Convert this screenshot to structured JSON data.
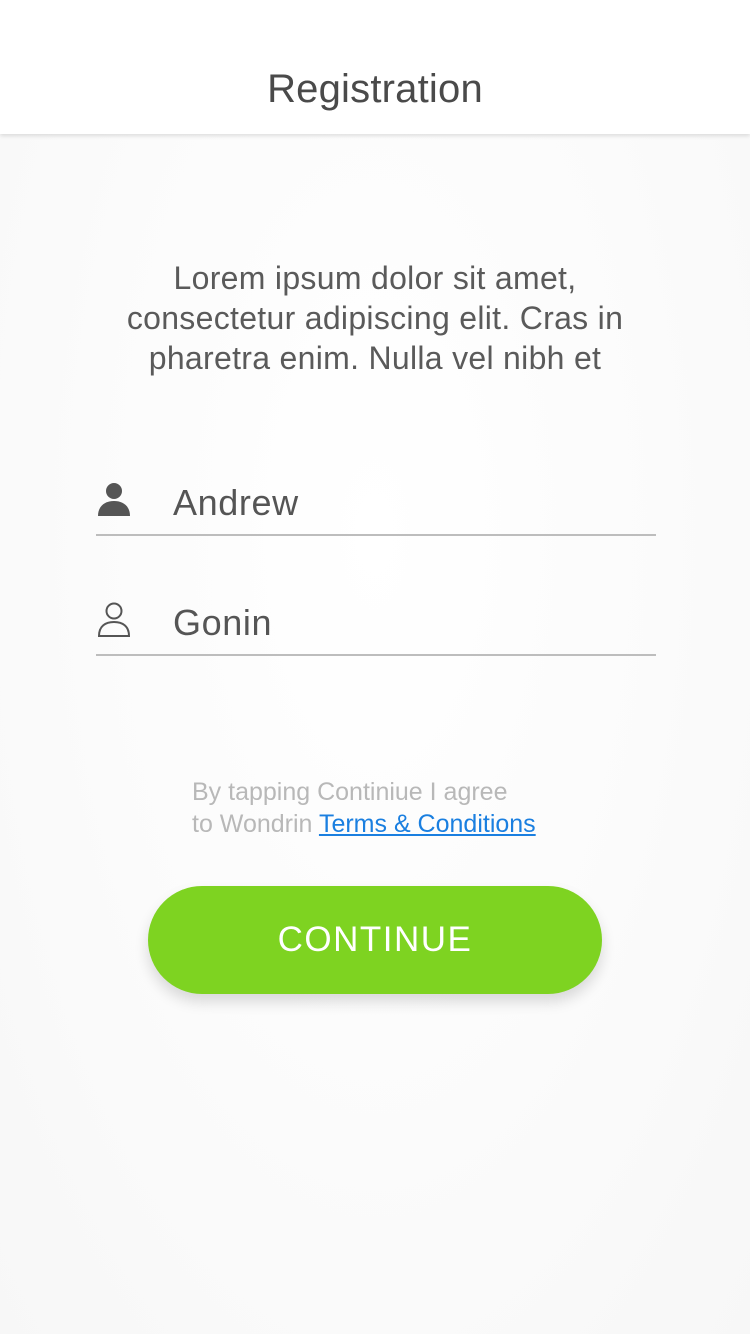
{
  "header": {
    "title": "Registration"
  },
  "intro": {
    "text": "Lorem ipsum dolor sit amet, consectetur adipiscing elit. Cras in pharetra enim. Nulla vel nibh et"
  },
  "form": {
    "first_name": {
      "value": "Andrew",
      "icon": "person-filled-icon"
    },
    "last_name": {
      "value": "Gonin",
      "icon": "person-outline-icon"
    }
  },
  "agreement": {
    "line1": "By tapping Continiue I agree",
    "line2_prefix": "to Wondrin ",
    "link_label": "Terms & Conditions"
  },
  "continue_button": {
    "label": "CONTINUE"
  },
  "colors": {
    "accent": "#7ed321",
    "link": "#1a7fe0"
  }
}
